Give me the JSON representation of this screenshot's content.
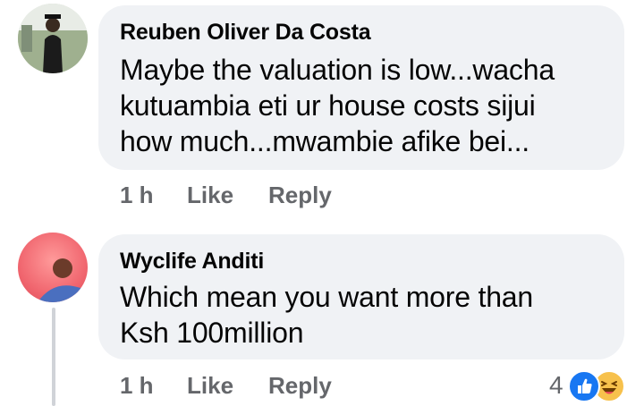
{
  "comments": [
    {
      "author": "Reuben Oliver Da Costa",
      "text_lines": [
        "Maybe the valuation is low...wacha",
        "kutuambia eti ur house costs sijui",
        "how much...mwambie afike bei..."
      ],
      "time": "1 h",
      "like_label": "Like",
      "reply_label": "Reply"
    },
    {
      "author": "Wyclife Anditi",
      "text_lines": [
        "Which mean you want more than",
        "Ksh 100million"
      ],
      "time": "1 h",
      "like_label": "Like",
      "reply_label": "Reply",
      "reaction_count": "4",
      "reactions": [
        "like-icon",
        "haha-icon"
      ]
    }
  ],
  "colors": {
    "bubble": "#f0f2f5",
    "action_text": "#65676b",
    "like_blue": "#1877f2",
    "haha_yellow": "#f7c14c"
  }
}
